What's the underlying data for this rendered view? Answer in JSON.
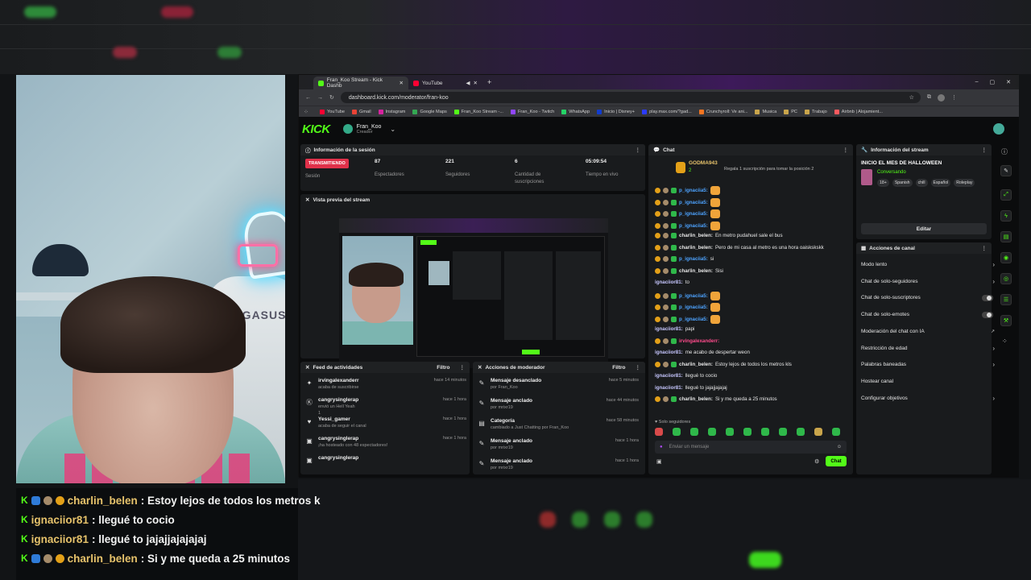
{
  "overlay_chat": [
    {
      "name": "charlin_belen",
      "message": ": Estoy lejos de todos los metros k"
    },
    {
      "name": "ignaciior81",
      "message": ": llegué to cocio"
    },
    {
      "name": "ignaciior81",
      "message": ": llegué to jajajjajajajaj"
    },
    {
      "name": "charlin_belen",
      "message": ": Si y me queda a 25 minutos"
    }
  ],
  "browser": {
    "tabs": [
      {
        "label": "Fran_Koo Stream - Kick Dashb",
        "fav_color": "#53fc18"
      },
      {
        "label": "YouTube",
        "fav_color": "#ff0033"
      }
    ],
    "url": "dashboard.kick.com/moderator/fran-koo",
    "bookmarks": [
      {
        "label": "YouTube",
        "color": "#ff0033"
      },
      {
        "label": "Gmail",
        "color": "#ea4335"
      },
      {
        "label": "Instagram",
        "color": "#d6249f"
      },
      {
        "label": "Google Maps",
        "color": "#34a853"
      },
      {
        "label": "Fran_Koo Stream -...",
        "color": "#53fc18"
      },
      {
        "label": "Fran_Koo - Twitch",
        "color": "#9146ff"
      },
      {
        "label": "WhatsApp",
        "color": "#25d366"
      },
      {
        "label": "Inicio | Disney+",
        "color": "#113ccf"
      },
      {
        "label": "play.max.com/?gad...",
        "color": "#2b3bff"
      },
      {
        "label": "Crunchyroll: Ve ani...",
        "color": "#f47521"
      },
      {
        "label": "Musica",
        "color": "#c9a54b"
      },
      {
        "label": "PC",
        "color": "#c9a54b"
      },
      {
        "label": "Trabajo",
        "color": "#c9a54b"
      },
      {
        "label": "Airbnb | Alojamient...",
        "color": "#ff5a5f"
      }
    ]
  },
  "dashboard": {
    "logo": "KICK",
    "user": {
      "name": "Fran_Koo",
      "role": "Creador"
    },
    "session": {
      "title": "Información de la sesión",
      "live_badge": "TRANSMITIENDO",
      "session_label": "Sesión",
      "stats": [
        {
          "value": "87",
          "label": "Espectadores"
        },
        {
          "value": "221",
          "label": "Seguidores"
        },
        {
          "value": "6",
          "label": "Cantidad de suscripciones"
        },
        {
          "value": "05:09:54",
          "label": "Tiempo en vivo"
        }
      ]
    },
    "preview_title": "Vista previa del stream",
    "activity": {
      "title": "Feed de actividades",
      "filter": "Filtro",
      "items": [
        {
          "user": "irvingalexanderr",
          "detail": "acaba de suscribirse",
          "time": "hace 14 minutos",
          "icon": "star"
        },
        {
          "user": "cangrysinglerap",
          "detail": "envió un Hell Yeah",
          "extra": "1",
          "time": "hace 1 hora",
          "icon": "kick"
        },
        {
          "user": "Yessi_gamer",
          "detail": "acaba de seguir el canal",
          "time": "hace 1 hora",
          "icon": "heart"
        },
        {
          "user": "cangrysinglerap",
          "detail": "¡ha hosteado con 48 espectadores!",
          "time": "hace 1 hora",
          "icon": "host"
        },
        {
          "user": "cangrysinglerap",
          "detail": "",
          "time": "",
          "icon": "host"
        }
      ]
    },
    "mod_actions": {
      "title": "Acciones de moderador",
      "filter": "Filtro",
      "items": [
        {
          "action": "Mensaje desanclado",
          "by": "por Fran_Koo",
          "time": "hace 5 minutos",
          "icon": "pin"
        },
        {
          "action": "Mensaje anclado",
          "by": "por mrixr19",
          "time": "hace 44 minutos",
          "icon": "pin"
        },
        {
          "action": "Categoría",
          "by": "cambiado a Just Chatting por Fran_Koo",
          "time": "hace 58 minutos",
          "icon": "tag"
        },
        {
          "action": "Mensaje anclado",
          "by": "por mrixr19",
          "time": "hace 1 hora",
          "icon": "pin"
        },
        {
          "action": "Mensaje anclado",
          "by": "por mrixr19",
          "time": "hace 1 hora",
          "icon": "pin"
        }
      ]
    },
    "chat": {
      "title": "Chat",
      "top_gifter": {
        "name": "GODMA943",
        "count": "2",
        "note": "Regala 1 suscripción para tomar la posición 2"
      },
      "lines": [
        {
          "user": "p_ignaciia5:",
          "msg": "",
          "color": "#4da3ff",
          "emote": true
        },
        {
          "user": "p_ignaciia5:",
          "msg": "",
          "color": "#4da3ff",
          "emote": true
        },
        {
          "user": "p_ignaciia5:",
          "msg": "",
          "color": "#4da3ff",
          "emote": true
        },
        {
          "user": "p_ignaciia5:",
          "msg": "",
          "color": "#4da3ff",
          "emote": true
        },
        {
          "user": "charlin_belen:",
          "msg": "En metro pudahuel sale el bus",
          "color": "#e6e6e6",
          "emote": false
        },
        {
          "user": "charlin_belen:",
          "msg": "Pero de mi casa al metro es una hora oaiskskskk",
          "color": "#e6e6e6",
          "emote": false
        },
        {
          "user": "p_ignaciia5:",
          "msg": "si",
          "color": "#4da3ff",
          "emote": false
        },
        {
          "user": "charlin_belen:",
          "msg": "Sisi",
          "color": "#e6e6e6",
          "emote": false
        },
        {
          "user": "ignaciior81:",
          "msg": "to",
          "color": "#c7c7ff",
          "emote": false
        },
        {
          "user": "p_ignaciia5:",
          "msg": "",
          "color": "#4da3ff",
          "emote": true
        },
        {
          "user": "p_ignaciia5:",
          "msg": "",
          "color": "#4da3ff",
          "emote": true
        },
        {
          "user": "p_ignaciia5:",
          "msg": "",
          "color": "#4da3ff",
          "emote": true
        },
        {
          "user": "ignaciior81:",
          "msg": "papi",
          "color": "#c7c7ff",
          "emote": false
        },
        {
          "user": "irvingalexanderr:",
          "msg": "",
          "color": "#ff4b8c",
          "emote": false
        },
        {
          "user": "ignaciior81:",
          "msg": "me acabo de despertar weon",
          "color": "#c7c7ff",
          "emote": false
        },
        {
          "user": "charlin_belen:",
          "msg": "Estoy lejos de todos los metros kls",
          "color": "#e6e6e6",
          "emote": false
        },
        {
          "user": "ignaciior81:",
          "msg": "llegué to cocio",
          "color": "#c7c7ff",
          "emote": false
        },
        {
          "user": "ignaciior81:",
          "msg": "llegué to jajajjajajaj",
          "color": "#c7c7ff",
          "emote": false
        },
        {
          "user": "charlin_belen:",
          "msg": "Si y me queda a 25 minutos",
          "color": "#e6e6e6",
          "emote": false
        }
      ],
      "followers_only": "Solo seguidores",
      "input_placeholder": "Enviar un mensaje",
      "send_label": "Chat"
    },
    "stream_info": {
      "title": "Información del stream",
      "stream_title": "INICIO EL MES DE HALLOWEEN",
      "category": "Conversando",
      "tags": [
        "18+",
        "Spanish",
        "chill",
        "Español",
        "Roleplay"
      ],
      "edit_label": "Editar"
    },
    "channel_actions": {
      "title": "Acciones de canal",
      "items": [
        {
          "label": "Modo lento",
          "control": "chevron"
        },
        {
          "label": "Chat de solo-seguidores",
          "control": "chevron"
        },
        {
          "label": "Chat de solo-suscriptores",
          "control": "toggle"
        },
        {
          "label": "Chat de solo-emotes",
          "control": "toggle"
        },
        {
          "label": "Moderación del chat con IA",
          "control": "external"
        },
        {
          "label": "Restricción de edad",
          "control": "chevron"
        },
        {
          "label": "Palabras baneadas",
          "control": "chevron"
        },
        {
          "label": "Hostear canal",
          "control": "none"
        },
        {
          "label": "Configurar objetivos",
          "control": "chevron"
        }
      ]
    }
  }
}
